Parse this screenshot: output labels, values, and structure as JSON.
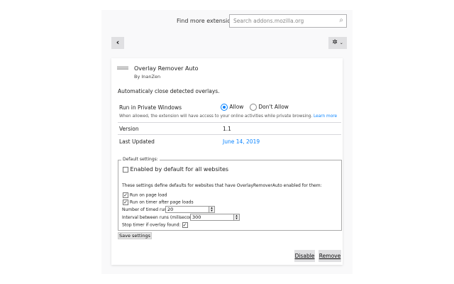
{
  "header": {
    "find_more": "Find more extensions",
    "search_placeholder": "Search addons.mozilla.org"
  },
  "addon": {
    "name": "Overlay Remover Auto",
    "author": "By InanZen",
    "description": "Automaticaly close detected overlays."
  },
  "private": {
    "label": "Run in Private Windows",
    "allow": "Allow",
    "dont_allow": "Don't Allow",
    "selected": "Allow",
    "note": "When allowed, the extension will have access to your online activities while private browsing.",
    "learn_more": "Learn more"
  },
  "details": {
    "version_label": "Version",
    "version": "1.1",
    "updated_label": "Last Updated",
    "updated": "June 14, 2019"
  },
  "settings": {
    "legend": "Default settings:",
    "enabled_all": "Enabled by default for all websites",
    "enabled_all_checked": false,
    "info": "These settings define defaults for websites that have OverlayRemoverAuto enabled for them:",
    "run_on_load": "Run on page load",
    "run_on_timer": "Run on timer after page loads",
    "timed_runs_label": "Number of timed runs:",
    "timed_runs": "20",
    "interval_label": "Interval between runs (miliseconds):",
    "interval": "300",
    "stop_label": "Stop timer if overlay found:",
    "save": "Save settings"
  },
  "actions": {
    "disable": "Disable",
    "remove": "Remove"
  },
  "colors": {
    "accent": "#0a84ff"
  }
}
